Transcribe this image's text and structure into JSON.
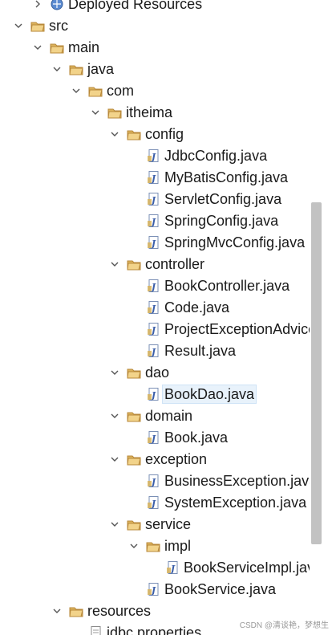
{
  "tree": {
    "items": [
      {
        "label": "Deployed Resources",
        "depth": 1,
        "type": "deployed",
        "expanded": false
      },
      {
        "label": "src",
        "depth": 0,
        "type": "folder",
        "expanded": true
      },
      {
        "label": "main",
        "depth": 1,
        "type": "folder",
        "expanded": true
      },
      {
        "label": "java",
        "depth": 2,
        "type": "folder",
        "expanded": true
      },
      {
        "label": "com",
        "depth": 3,
        "type": "folder",
        "expanded": true
      },
      {
        "label": "itheima",
        "depth": 4,
        "type": "folder",
        "expanded": true
      },
      {
        "label": "config",
        "depth": 5,
        "type": "folder",
        "expanded": true
      },
      {
        "label": "JdbcConfig.java",
        "depth": 6,
        "type": "java"
      },
      {
        "label": "MyBatisConfig.java",
        "depth": 6,
        "type": "java"
      },
      {
        "label": "ServletConfig.java",
        "depth": 6,
        "type": "java"
      },
      {
        "label": "SpringConfig.java",
        "depth": 6,
        "type": "java"
      },
      {
        "label": "SpringMvcConfig.java",
        "depth": 6,
        "type": "java"
      },
      {
        "label": "controller",
        "depth": 5,
        "type": "folder",
        "expanded": true
      },
      {
        "label": "BookController.java",
        "depth": 6,
        "type": "java"
      },
      {
        "label": "Code.java",
        "depth": 6,
        "type": "java"
      },
      {
        "label": "ProjectExceptionAdvice.java",
        "depth": 6,
        "type": "java"
      },
      {
        "label": "Result.java",
        "depth": 6,
        "type": "java"
      },
      {
        "label": "dao",
        "depth": 5,
        "type": "folder",
        "expanded": true
      },
      {
        "label": "BookDao.java",
        "depth": 6,
        "type": "java",
        "selected": true
      },
      {
        "label": "domain",
        "depth": 5,
        "type": "folder",
        "expanded": true
      },
      {
        "label": "Book.java",
        "depth": 6,
        "type": "java"
      },
      {
        "label": "exception",
        "depth": 5,
        "type": "folder",
        "expanded": true
      },
      {
        "label": "BusinessException.java",
        "depth": 6,
        "type": "java"
      },
      {
        "label": "SystemException.java",
        "depth": 6,
        "type": "java"
      },
      {
        "label": "service",
        "depth": 5,
        "type": "folder",
        "expanded": true
      },
      {
        "label": "impl",
        "depth": 6,
        "type": "folder",
        "expanded": true
      },
      {
        "label": "BookServiceImpl.java",
        "depth": 7,
        "type": "java"
      },
      {
        "label": "BookService.java",
        "depth": 6,
        "type": "java"
      },
      {
        "label": "resources",
        "depth": 2,
        "type": "folder",
        "expanded": true
      },
      {
        "label": "jdbc.properties",
        "depth": 3,
        "type": "file"
      }
    ]
  },
  "watermark": "CSDN @清谈艳，梦想生",
  "colors": {
    "folder": "#dcb35c",
    "folder_dark": "#b8893b",
    "java_blue": "#3b5ea8",
    "selection": "#e8f2fb",
    "scroll_thumb": "#c2c2c2"
  }
}
